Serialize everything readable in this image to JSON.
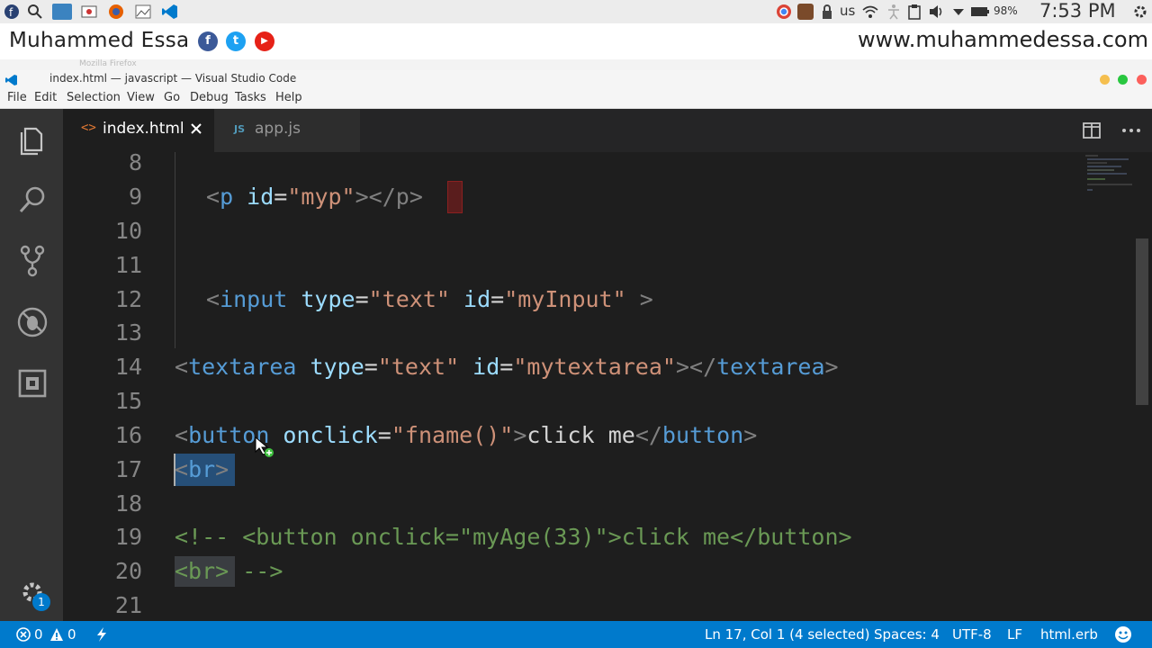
{
  "os_panel": {
    "keyboard_layout": "us",
    "battery": "98%",
    "clock": "7:53 PM"
  },
  "branding": {
    "name": "Muhammed Essa",
    "url": "www.muhammedessa.com",
    "social_facebook": "f",
    "social_twitter": "t",
    "social_youtube": "▶"
  },
  "firefox_ghost_title": "Mozilla Firefox",
  "window": {
    "title": "index.html — javascript — Visual Studio Code"
  },
  "menu": [
    "File",
    "Edit",
    "Selection",
    "View",
    "Go",
    "Debug",
    "Tasks",
    "Help"
  ],
  "tabs": [
    {
      "label": "index.html",
      "icon": "html-file-icon",
      "active": true
    },
    {
      "label": "app.js",
      "icon": "js-file-icon",
      "active": false
    }
  ],
  "tab_icons": {
    "html": "<>",
    "js": "JS"
  },
  "editor": {
    "lines": [
      {
        "num": "8"
      },
      {
        "num": "9"
      },
      {
        "num": "10"
      },
      {
        "num": "11"
      },
      {
        "num": "12"
      },
      {
        "num": "13"
      },
      {
        "num": "14"
      },
      {
        "num": "15"
      },
      {
        "num": "16"
      },
      {
        "num": "17"
      },
      {
        "num": "18"
      },
      {
        "num": "19"
      },
      {
        "num": "20"
      },
      {
        "num": "21"
      }
    ],
    "tokens": {
      "l9_open": "<",
      "l9_tag": "p",
      "l9_attr": " id",
      "l9_eq": "=",
      "l9_str": "\"myp\"",
      "l9_rest": "></p>",
      "l12_open": "<",
      "l12_tag": "input",
      "l12_attr1": " type",
      "l12_eq1": "=",
      "l12_str1": "\"text\"",
      "l12_attr2": " id",
      "l12_eq2": "=",
      "l12_str2": "\"myInput\"",
      "l12_close": " >",
      "l14_open": "<",
      "l14_tag": "textarea",
      "l14_attr1": " type",
      "l14_eq1": "=",
      "l14_str1": "\"text\"",
      "l14_attr2": " id",
      "l14_eq2": "=",
      "l14_str2": "\"mytextarea\"",
      "l14_mid": "></",
      "l14_tag2": "textarea",
      "l14_end": ">",
      "l16_open": "<",
      "l16_tag": "button",
      "l16_attr": " onclick",
      "l16_eq": "=",
      "l16_str": "\"fname()\"",
      "l16_gt": ">",
      "l16_text": "click me",
      "l16_close_open": "</",
      "l16_tag2": "button",
      "l16_end": ">",
      "l17_open": "<",
      "l17_tag": "br",
      "l17_end": ">",
      "l19_comment": "<!-- <button onclick=\"myAge(33)\">click me</button>",
      "l20_comment": "<br> -->"
    }
  },
  "status": {
    "errors": "0",
    "warnings": "0",
    "position": "Ln 17, Col 1 (4 selected)",
    "spaces": "Spaces: 4",
    "encoding": "UTF-8",
    "eol": "LF",
    "language": "html.erb",
    "notification_count": "1"
  },
  "colors": {
    "status_bar": "#007acc",
    "activity_bar": "#333333",
    "editor_bg": "#1e1e1e",
    "selection": "#264f78"
  }
}
